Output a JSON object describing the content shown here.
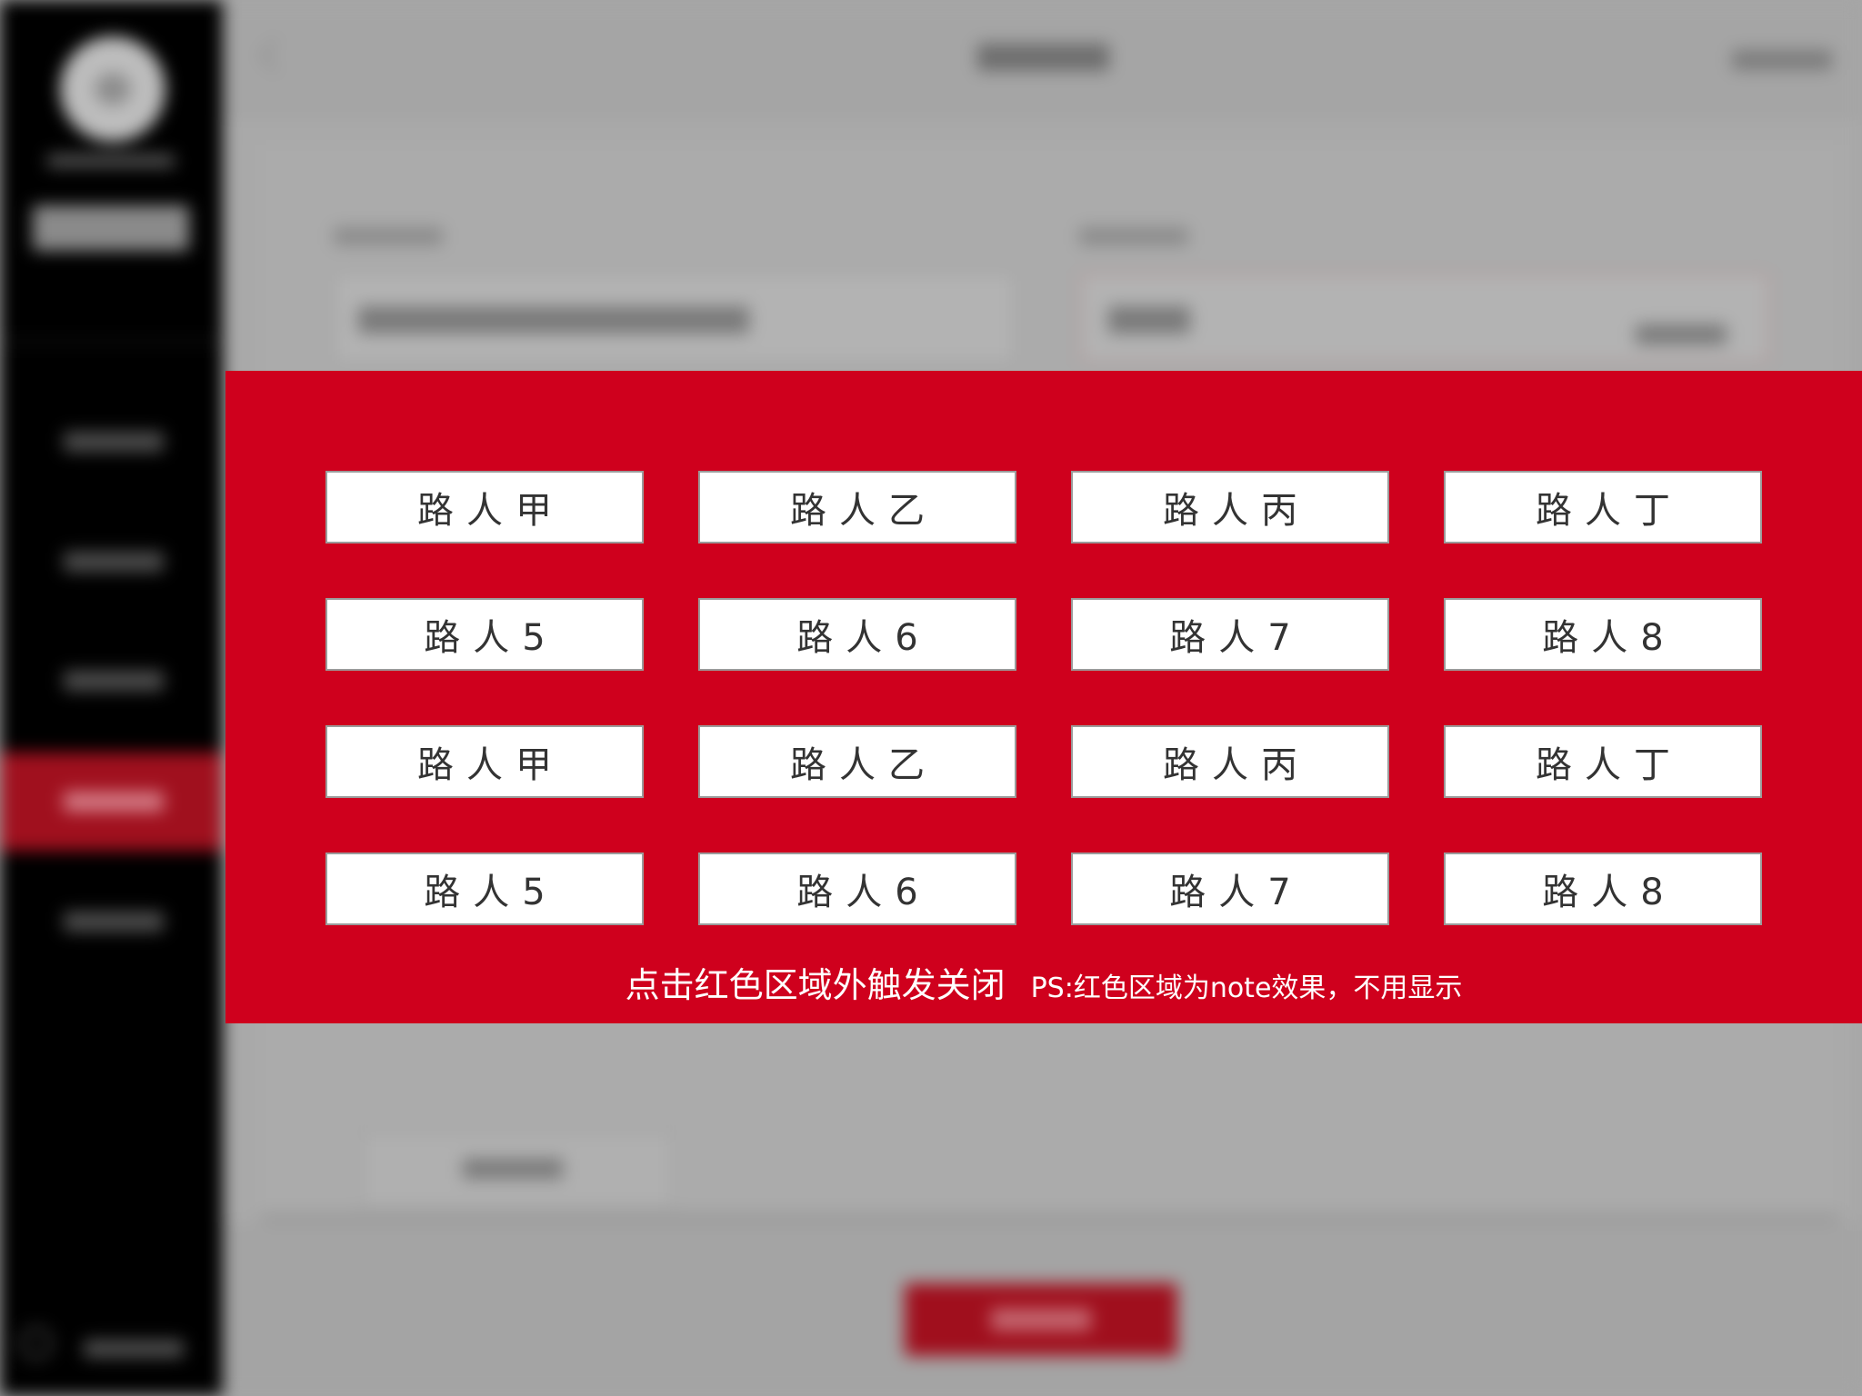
{
  "overlay": {
    "background_color": "#cf001d",
    "buttons": [
      "路人甲",
      "路人乙",
      "路人丙",
      "路人丁",
      "路人5",
      "路人6",
      "路人7",
      "路人8",
      "路人甲",
      "路人乙",
      "路人丙",
      "路人丁",
      "路人5",
      "路人6",
      "路人7",
      "路人8"
    ],
    "close_hint": "点击红色区域外触发关闭",
    "ps_note": "PS:红色区域为note效果，不用显示"
  },
  "background": {
    "sidebar_color": "#000000",
    "active_item_color": "#a0101e",
    "accent_button_color": "#a00f1d"
  }
}
